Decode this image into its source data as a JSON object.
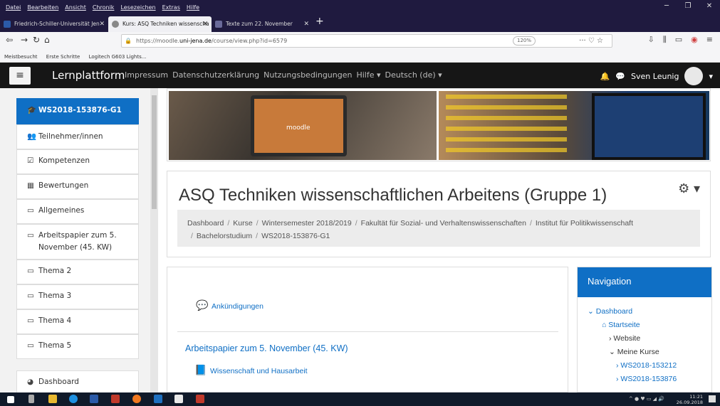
{
  "browser": {
    "menu": [
      "Datei",
      "Bearbeiten",
      "Ansicht",
      "Chronik",
      "Lesezeichen",
      "Extras",
      "Hilfe"
    ],
    "tabs": [
      {
        "title": "Friedrich-Schiller-Universität Jen",
        "close": "✕"
      },
      {
        "title": "Kurs: ASQ Techniken wissenscha",
        "close": "✕"
      },
      {
        "title": "Texte zum 22. November",
        "close": "✕"
      }
    ],
    "new_tab": "+",
    "url_prefix": "https://moodle.",
    "url_domain": "uni-jena.de",
    "url_path": "/course/view.php?id=6579",
    "zoom": "120%",
    "url_actions": "··· ♡ ☆",
    "bookmarks": [
      "Meistbesucht",
      "Erste Schritte",
      "Logitech G603 Lights..."
    ]
  },
  "header": {
    "menu_icon": "≡",
    "brand": "Lernplattform",
    "links": [
      "Impressum",
      "Datenschutzerklärung",
      "Nutzungsbedingungen",
      "Hilfe ▾",
      "Deutsch (de) ▾"
    ],
    "user_name": "Sven Leunig",
    "colors": {
      "bar": "#161616",
      "accent": "#0f6fc5"
    }
  },
  "drawer": {
    "items": [
      {
        "label": "WS2018-153876-G1",
        "icon": "graduation-cap-icon"
      },
      {
        "label": "Teilnehmer/innen",
        "icon": "users-icon"
      },
      {
        "label": "Kompetenzen",
        "icon": "checkbox-icon"
      },
      {
        "label": "Bewertungen",
        "icon": "table-icon"
      },
      {
        "label": "Allgemeines",
        "icon": "folder-icon"
      },
      {
        "label": "Arbeitspapier zum 5. November (45. KW)",
        "icon": "folder-icon"
      },
      {
        "label": "Thema 2",
        "icon": "folder-icon"
      },
      {
        "label": "Thema 3",
        "icon": "folder-icon"
      },
      {
        "label": "Thema 4",
        "icon": "folder-icon"
      },
      {
        "label": "Thema 5",
        "icon": "folder-icon"
      },
      {
        "label": "Dashboard",
        "icon": "dashboard-icon"
      }
    ]
  },
  "course": {
    "title": "ASQ Techniken wissenschaftlichen Arbeitens (Gruppe 1)",
    "breadcrumb": [
      "Dashboard",
      "Kurse",
      "Wintersemester 2018/2019",
      "Fakultät für Sozial- und Verhaltenswissenschaften",
      "Institut für Politikwissenschaft",
      "Bachelorstudium",
      "WS2018-153876-G1"
    ],
    "announcements": "Ankündigungen",
    "section_title": "Arbeitspapier zum 5. November (45. KW)",
    "resource": "Wissenschaft und Hausarbeit"
  },
  "navigation": {
    "title": "Navigation",
    "items": [
      {
        "label": "Dashboard",
        "prefix": "⌄"
      },
      {
        "label": "Startseite",
        "prefix": "⌂"
      },
      {
        "label": "Website",
        "prefix": "›"
      },
      {
        "label": "Meine Kurse",
        "prefix": "⌄"
      },
      {
        "label": "WS2018-153212",
        "prefix": "›"
      },
      {
        "label": "WS2018-153876",
        "prefix": "›"
      }
    ]
  },
  "taskbar": {
    "time": "11:21",
    "date": "26.09.2018",
    "tray_icons": "^ ● ♥ ▭ ◢ 🔊"
  }
}
